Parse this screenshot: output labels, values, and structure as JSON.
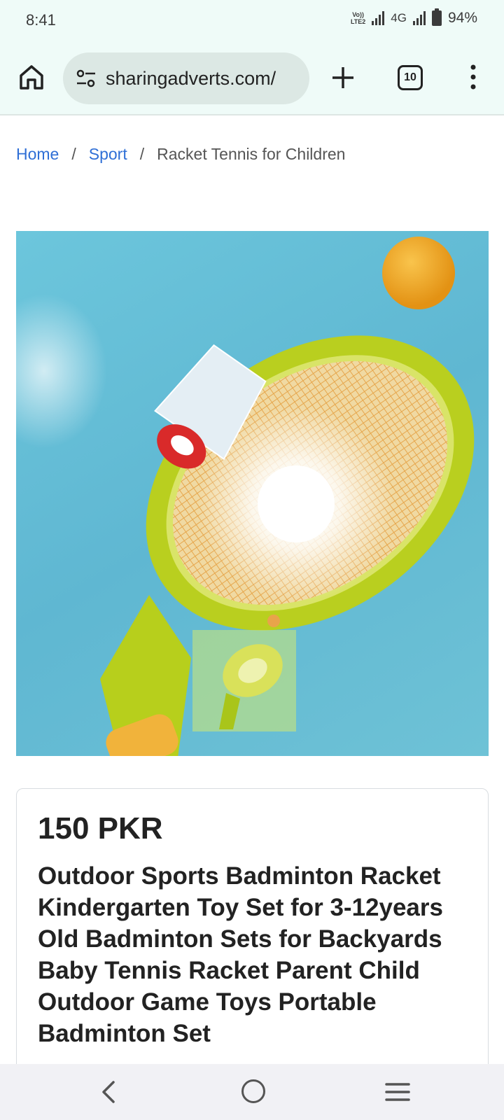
{
  "status_bar": {
    "time": "8:41",
    "volte_line1": "Vo))",
    "volte_line2": "LTE2",
    "network": "4G",
    "battery": "94%"
  },
  "browser": {
    "url": "sharingadverts.com/",
    "tab_count": "10"
  },
  "breadcrumb": {
    "home": "Home",
    "category": "Sport",
    "separator": "/",
    "current": "Racket Tennis for Children"
  },
  "product": {
    "price": "150 PKR",
    "title": "Outdoor Sports Badminton Racket Kindergarten Toy Set for 3-12years Old Badminton Sets for Backyards Baby Tennis Racket Parent Child Outdoor Game Toys Portable Badminton Set"
  }
}
